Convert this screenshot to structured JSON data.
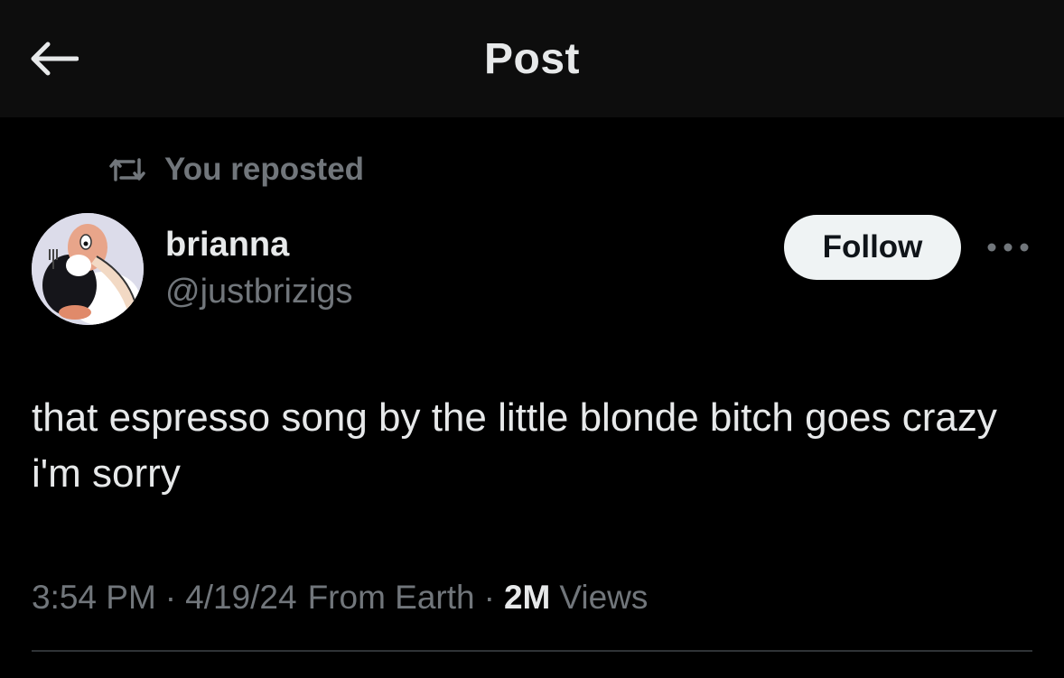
{
  "header": {
    "title": "Post",
    "back_icon": "arrow-left-icon"
  },
  "repost": {
    "label": "You reposted",
    "icon": "repost-icon"
  },
  "author": {
    "name": "brianna",
    "handle": "@justbrizigs",
    "avatar": "cartoon-vulture-avatar"
  },
  "actions": {
    "follow_label": "Follow",
    "more_icon": "more-horizontal-icon"
  },
  "post": {
    "text": "that espresso song by the little blonde bitch goes crazy i'm sorry"
  },
  "meta": {
    "time": "3:54 PM",
    "date": "4/19/24",
    "location": "From Earth",
    "views_count": "2M",
    "views_label": "Views",
    "separator": "·"
  },
  "colors": {
    "background": "#000000",
    "header_background": "#0d0d0d",
    "primary_text": "#e7e9ea",
    "secondary_text": "#71767b",
    "follow_button_bg": "#eff3f4",
    "divider": "#2f3336"
  }
}
